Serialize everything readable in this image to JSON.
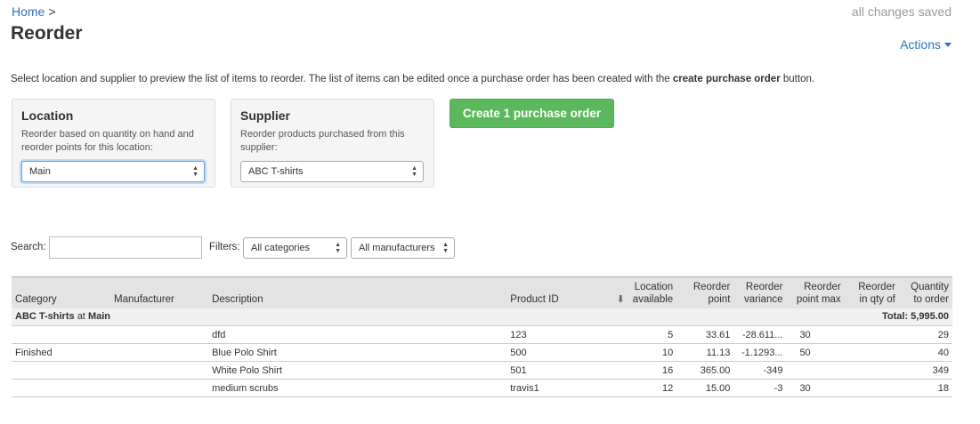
{
  "header": {
    "breadcrumb_home": "Home",
    "breadcrumb_sep": ">",
    "title": "Reorder",
    "save_status": "all changes saved",
    "actions_label": "Actions"
  },
  "intro": {
    "text_before": "Select location and supplier to preview the list of items to reorder. The list of items can be edited once a purchase order has been created with the ",
    "bold": "create purchase order",
    "text_after": " button."
  },
  "location_panel": {
    "title": "Location",
    "description": "Reorder based on quantity on hand and reorder points for this location:",
    "selected": "Main"
  },
  "supplier_panel": {
    "title": "Supplier",
    "description": "Reorder products purchased from this supplier:",
    "selected": "ABC T-shirts"
  },
  "create_button": "Create 1 purchase order",
  "search": {
    "label": "Search:",
    "value": ""
  },
  "filters": {
    "label": "Filters:",
    "category": "All categories",
    "manufacturer": "All manufacturers"
  },
  "table": {
    "columns": {
      "category": "Category",
      "manufacturer": "Manufacturer",
      "description": "Description",
      "product_id": "Product ID",
      "location_available": "Location available",
      "reorder_point": "Reorder point",
      "reorder_variance": "Reorder variance",
      "reorder_point_max": "Reorder point max",
      "reorder_in_qty_of": "Reorder in qty of",
      "quantity_to_order": "Quantity to order"
    },
    "group": {
      "supplier": "ABC T-shirts",
      "at": "at",
      "location": "Main",
      "total": "Total: 5,995.00"
    },
    "rows": [
      {
        "category": "",
        "manufacturer": "",
        "description": "dfd",
        "product_id": "123",
        "available": "5",
        "reorder_point": "33.61",
        "variance": "-28.611...",
        "point_max": "30",
        "qty_of": "",
        "to_order": "29"
      },
      {
        "category": "Finished",
        "manufacturer": "",
        "description": "Blue Polo Shirt",
        "product_id": "500",
        "available": "10",
        "reorder_point": "11.13",
        "variance": "-1.1293...",
        "point_max": "50",
        "qty_of": "",
        "to_order": "40"
      },
      {
        "category": "",
        "manufacturer": "",
        "description": "White Polo Shirt",
        "product_id": "501",
        "available": "16",
        "reorder_point": "365.00",
        "variance": "-349",
        "point_max": "",
        "qty_of": "",
        "to_order": "349"
      },
      {
        "category": "",
        "manufacturer": "",
        "description": "medium scrubs",
        "product_id": "travis1",
        "available": "12",
        "reorder_point": "15.00",
        "variance": "-3",
        "point_max": "30",
        "qty_of": "",
        "to_order": "18"
      }
    ]
  },
  "icons": {
    "sort": "sort-down-icon",
    "select_arrows": "select-arrows-icon",
    "caret": "caret-down-icon"
  },
  "colors": {
    "link": "#2a72c4",
    "primary_button": "#5cb85c",
    "muted": "#999999"
  }
}
